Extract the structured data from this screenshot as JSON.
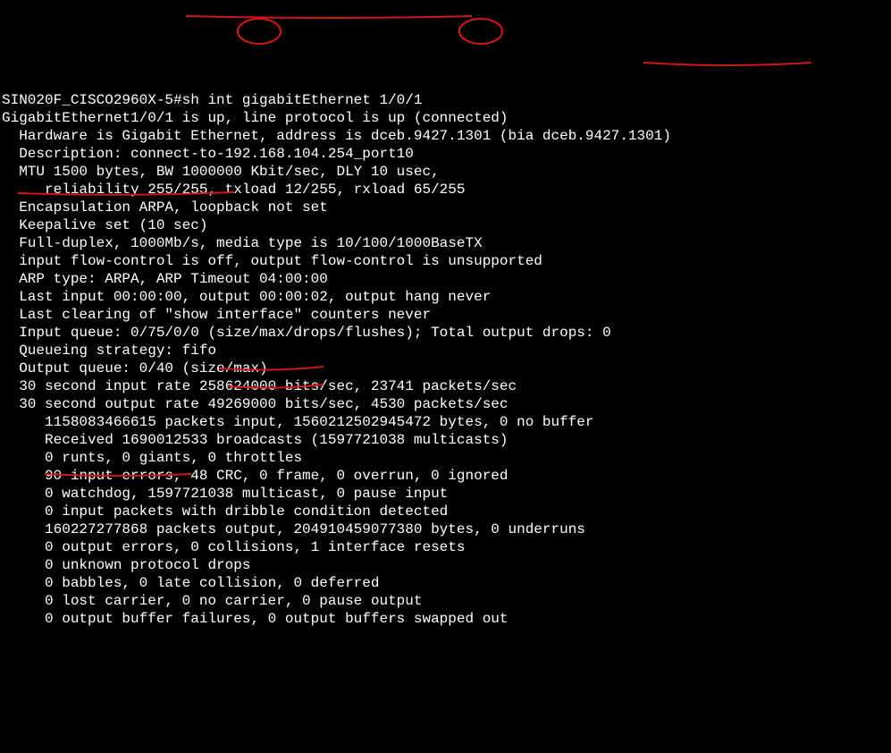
{
  "prompt": "SIN020F_CISCO2960X-5#",
  "command": "sh int gigabitEthernet 1/0/1",
  "lines": {
    "l1": "GigabitEthernet1/0/1 is up, line protocol is up (connected)",
    "l2": "  Hardware is Gigabit Ethernet, address is dceb.9427.1301 (bia dceb.9427.1301)",
    "l3": "  Description: connect-to-192.168.104.254_port10",
    "l4": "  MTU 1500 bytes, BW 1000000 Kbit/sec, DLY 10 usec,",
    "l5": "     reliability 255/255, txload 12/255, rxload 65/255",
    "l6": "  Encapsulation ARPA, loopback not set",
    "l7": "  Keepalive set (10 sec)",
    "l8": "  Full-duplex, 1000Mb/s, media type is 10/100/1000BaseTX",
    "l9": "  input flow-control is off, output flow-control is unsupported",
    "l10": "  ARP type: ARPA, ARP Timeout 04:00:00",
    "l11": "  Last input 00:00:00, output 00:00:02, output hang never",
    "l12": "  Last clearing of \"show interface\" counters never",
    "l13": "  Input queue: 0/75/0/0 (size/max/drops/flushes); Total output drops: 0",
    "l14": "  Queueing strategy: fifo",
    "l15": "  Output queue: 0/40 (size/max)",
    "l16": "  30 second input rate 258624000 bits/sec, 23741 packets/sec",
    "l17": "  30 second output rate 49269000 bits/sec, 4530 packets/sec",
    "l18": "     1158083466615 packets input, 1560212502945472 bytes, 0 no buffer",
    "l19": "     Received 1690012533 broadcasts (1597721038 multicasts)",
    "l20": "     0 runts, 0 giants, 0 throttles",
    "l21": "     90 input errors, 48 CRC, 0 frame, 0 overrun, 0 ignored",
    "l22": "     0 watchdog, 1597721038 multicast, 0 pause input",
    "l23": "     0 input packets with dribble condition detected",
    "l24": "     160227277868 packets output, 204910459077380 bytes, 0 underruns",
    "l25": "     0 output errors, 0 collisions, 1 interface resets",
    "l26": "     0 unknown protocol drops",
    "l27": "     0 babbles, 0 late collision, 0 deferred",
    "l28": "     0 lost carrier, 0 no carrier, 0 pause output",
    "l29": "     0 output buffer failures, 0 output buffers swapped out"
  }
}
